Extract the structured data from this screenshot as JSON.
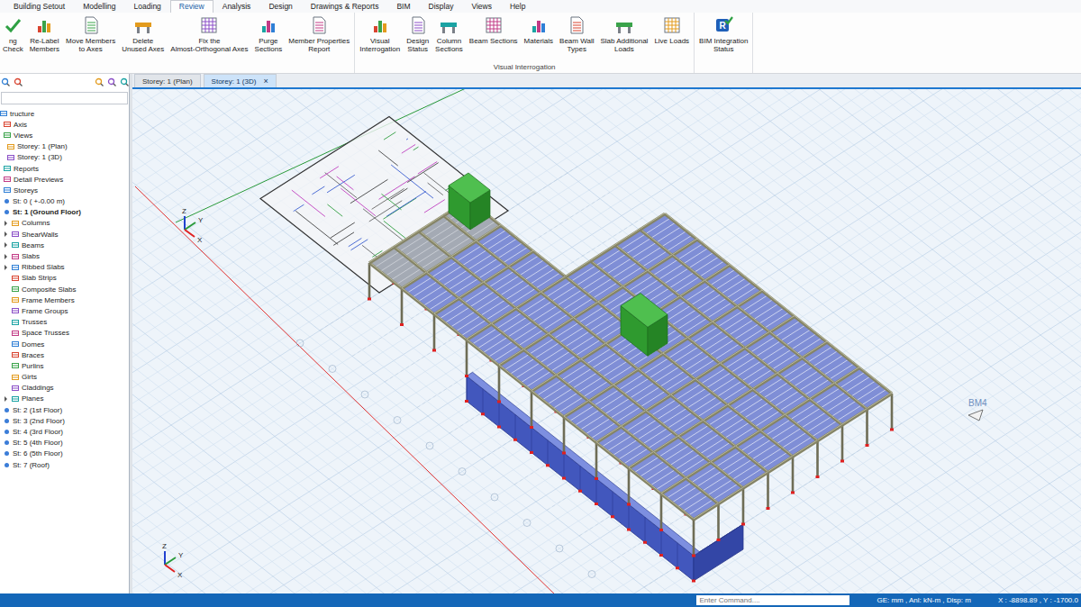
{
  "menu_tabs": [
    {
      "label": "Building Setout",
      "selected": false
    },
    {
      "label": "Modelling",
      "selected": false
    },
    {
      "label": "Loading",
      "selected": false
    },
    {
      "label": "Review",
      "selected": true
    },
    {
      "label": "Analysis",
      "selected": false
    },
    {
      "label": "Design",
      "selected": false
    },
    {
      "label": "Drawings & Reports",
      "selected": false
    },
    {
      "label": "BIM",
      "selected": false
    },
    {
      "label": "Display",
      "selected": false
    },
    {
      "label": "Views",
      "selected": false
    },
    {
      "label": "Help",
      "selected": false
    }
  ],
  "ribbon": {
    "groups": [
      {
        "buttons": [
          {
            "lines": [
              "ng",
              "Check"
            ]
          },
          {
            "lines": [
              "Re-Label",
              "Members"
            ]
          },
          {
            "lines": [
              "Move Members",
              "to Axes"
            ]
          },
          {
            "lines": [
              "Delete",
              "Unused Axes"
            ]
          },
          {
            "lines": [
              "Fix the",
              "Almost-Orthogonal Axes"
            ]
          },
          {
            "lines": [
              "Purge",
              "Sections"
            ]
          },
          {
            "lines": [
              "Member Properties",
              "Report"
            ]
          }
        ]
      },
      {
        "label": "Visual Interrogation",
        "buttons": [
          {
            "lines": [
              "Visual",
              "Interrogation"
            ]
          },
          {
            "lines": [
              "Design",
              "Status"
            ]
          },
          {
            "lines": [
              "Column",
              "Sections"
            ]
          },
          {
            "lines": [
              "Beam Sections"
            ]
          },
          {
            "lines": [
              "Materials"
            ]
          },
          {
            "lines": [
              "Beam Wall",
              "Types"
            ]
          },
          {
            "lines": [
              "Slab Additional",
              "Loads"
            ]
          },
          {
            "lines": [
              "Live Loads"
            ]
          }
        ]
      },
      {
        "buttons": [
          {
            "lines": [
              "BIM Integration",
              "Status"
            ],
            "icon_text": "R"
          }
        ]
      }
    ]
  },
  "tree": {
    "items": [
      {
        "label": "tructure",
        "depth": 0,
        "kind": "plain",
        "current": false
      },
      {
        "label": "Axis",
        "depth": 1,
        "kind": "plain",
        "current": false
      },
      {
        "label": "Views",
        "depth": 1,
        "kind": "plain",
        "current": false
      },
      {
        "label": "Storey: 1 (Plan)",
        "depth": 2,
        "kind": "plain",
        "current": false
      },
      {
        "label": "Storey: 1 (3D)",
        "depth": 2,
        "kind": "plain",
        "current": false
      },
      {
        "label": "Reports",
        "depth": 1,
        "kind": "plain",
        "current": false
      },
      {
        "label": "Detail Previews",
        "depth": 1,
        "kind": "plain",
        "current": false
      },
      {
        "label": "Storeys",
        "depth": 1,
        "kind": "plain",
        "current": false
      },
      {
        "label": "St: 0 ( +-0.00 m)",
        "depth": 1,
        "kind": "storey",
        "current": false
      },
      {
        "label": "St: 1 (Ground Floor)",
        "depth": 1,
        "kind": "storey",
        "current": true
      },
      {
        "label": "Columns",
        "depth": 1,
        "kind": "collapsed",
        "current": false
      },
      {
        "label": "ShearWalls",
        "depth": 1,
        "kind": "collapsed",
        "current": false
      },
      {
        "label": "Beams",
        "depth": 1,
        "kind": "collapsed",
        "current": false
      },
      {
        "label": "Slabs",
        "depth": 1,
        "kind": "collapsed",
        "current": false
      },
      {
        "label": "Ribbed Slabs",
        "depth": 1,
        "kind": "collapsed",
        "current": false
      },
      {
        "label": "Slab Strips",
        "depth": 1,
        "kind": "child",
        "current": false
      },
      {
        "label": "Composite Slabs",
        "depth": 1,
        "kind": "child",
        "current": false
      },
      {
        "label": "Frame Members",
        "depth": 1,
        "kind": "child",
        "current": false
      },
      {
        "label": "Frame Groups",
        "depth": 1,
        "kind": "child",
        "current": false
      },
      {
        "label": "Trusses",
        "depth": 1,
        "kind": "child",
        "current": false
      },
      {
        "label": "Space Trusses",
        "depth": 1,
        "kind": "child",
        "current": false
      },
      {
        "label": "Domes",
        "depth": 1,
        "kind": "child",
        "current": false
      },
      {
        "label": "Braces",
        "depth": 1,
        "kind": "child",
        "current": false
      },
      {
        "label": "Purlins",
        "depth": 1,
        "kind": "child",
        "current": false
      },
      {
        "label": "Girts",
        "depth": 1,
        "kind": "child",
        "current": false
      },
      {
        "label": "Claddings",
        "depth": 1,
        "kind": "child",
        "current": false
      },
      {
        "label": "Planes",
        "depth": 1,
        "kind": "collapsed",
        "current": false
      },
      {
        "label": "St: 2 (1st Floor)",
        "depth": 1,
        "kind": "storey",
        "current": false
      },
      {
        "label": "St: 3 (2nd Floor)",
        "depth": 1,
        "kind": "storey",
        "current": false
      },
      {
        "label": "St: 4 (3rd Floor)",
        "depth": 1,
        "kind": "storey",
        "current": false
      },
      {
        "label": "St: 5 (4th Floor)",
        "depth": 1,
        "kind": "storey",
        "current": false
      },
      {
        "label": "St: 6 (5th Floor)",
        "depth": 1,
        "kind": "storey",
        "current": false
      },
      {
        "label": "St: 7 (Roof)",
        "depth": 1,
        "kind": "storey",
        "current": false
      }
    ]
  },
  "document_tabs": [
    {
      "label": "Storey: 1 (Plan)",
      "selected": false
    },
    {
      "label": "Storey: 1 (3D)",
      "selected": true,
      "close": "×"
    }
  ],
  "viewport": {
    "origin_triad": [
      "Z",
      "Y",
      "X"
    ],
    "corner_triad": [
      "Z",
      "Y",
      "X"
    ],
    "axis_label": "BM4"
  },
  "status_bar": {
    "command": {
      "placeholder": "Enter Command...."
    },
    "units": "GE: mm , Anl: kN-m , Disp: m",
    "coordinates": "X : -8898.89 , Y : -1700.0"
  }
}
